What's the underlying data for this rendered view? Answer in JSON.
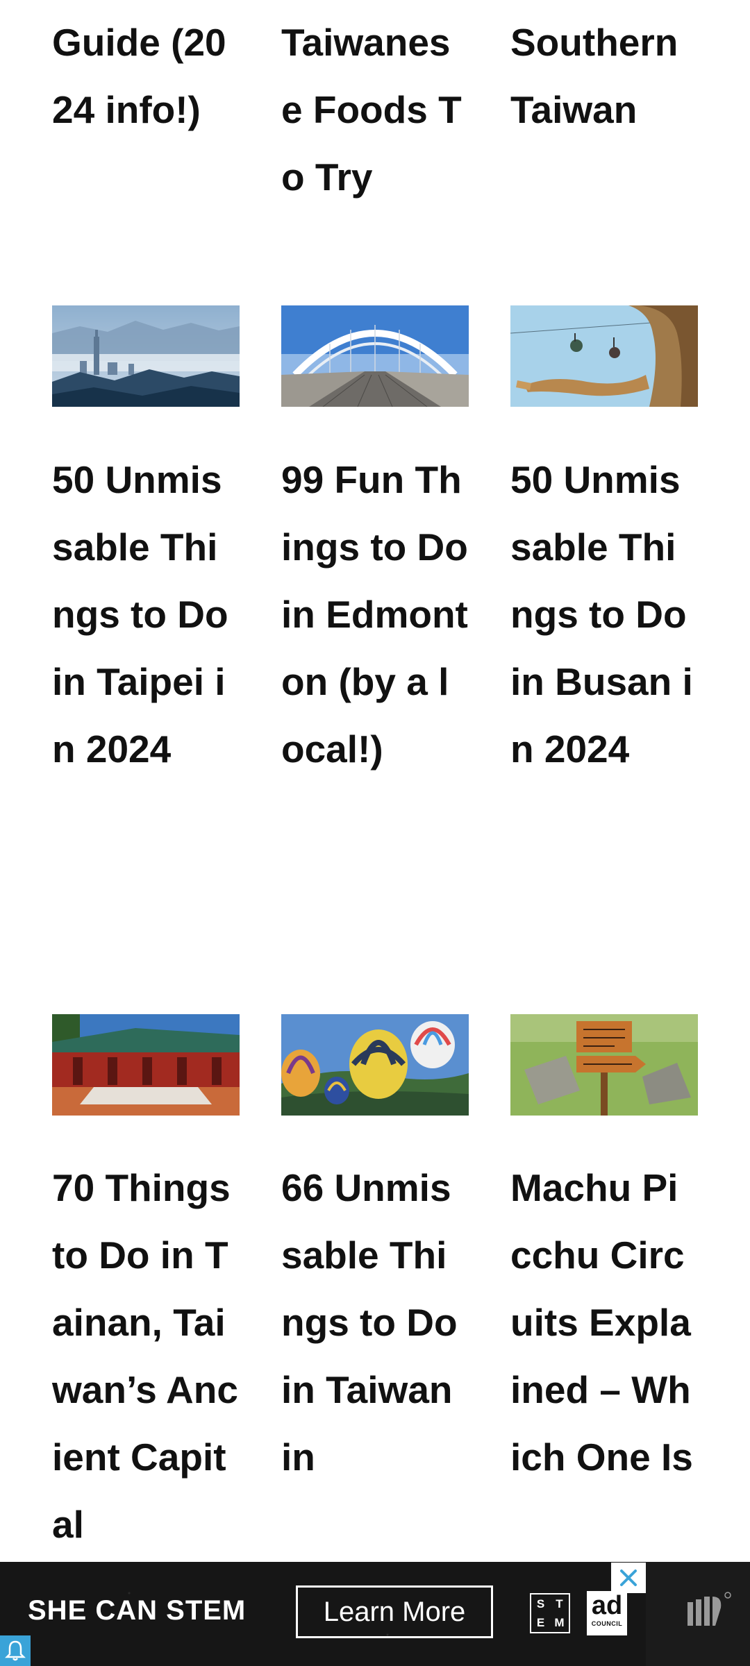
{
  "articles_row0": [
    {
      "title": "Guide (2024 info!)"
    },
    {
      "title": "Taiwanese Foods To Try"
    },
    {
      "title": "Southern Taiwan"
    }
  ],
  "articles_row1": [
    {
      "title": "50 Unmissable Things to Do in Taipei in 2024",
      "image": "taipei-skyline-in-mist"
    },
    {
      "title": "99 Fun Things to Do in Edmonton (by a local!)",
      "image": "edmonton-white-arch-bridge"
    },
    {
      "title": "50 Unmissable Things to Do in Busan in 2024",
      "image": "busan-statue-and-cable-cars"
    }
  ],
  "articles_row2": [
    {
      "title": "70 Things to Do in Tainan, Taiwan’s Ancient Capital",
      "image": "tainan-confucius-temple"
    },
    {
      "title": "66 Unmissable Things to Do in Taiwan in",
      "image": "taiwan-hot-air-balloons"
    },
    {
      "title": "Machu Picchu Circuits Explained – Which One Is",
      "image": "machu-picchu-circuit-signpost"
    }
  ],
  "ad": {
    "headline": "SHE CAN STEM",
    "cta": "Learn More",
    "stem_logo": [
      "S",
      "T",
      "E",
      "M"
    ],
    "council_big": "ad",
    "council_small": "COUNCIL",
    "close_icon": "close-x-icon",
    "side_logo": "publisher-logo"
  },
  "notification_icon": "bell-icon",
  "colors": {
    "title_text": "#111111",
    "ad_background": "#161616",
    "ad_close": "#3aa3d8",
    "bell_badge": "#3aa3d8"
  }
}
